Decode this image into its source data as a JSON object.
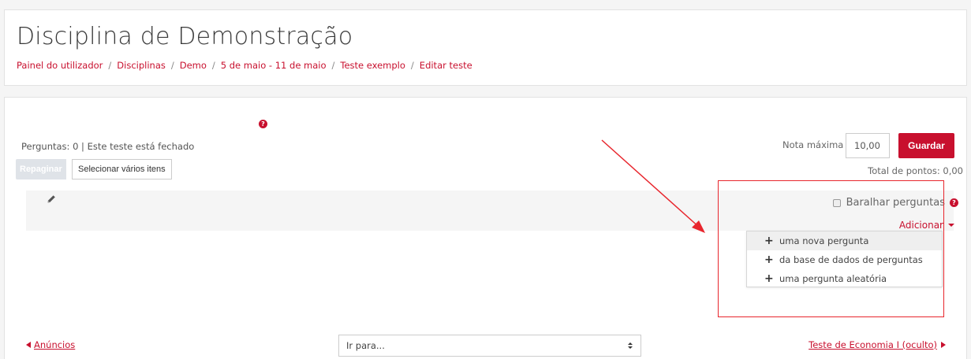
{
  "header": {
    "title": "Disciplina de Demonstração",
    "breadcrumb": [
      "Painel do utilizador",
      "Disciplinas",
      "Demo",
      "5 de maio - 11 de maio",
      "Teste exemplo",
      "Editar teste"
    ],
    "separator": "/"
  },
  "quiz": {
    "status": "Perguntas: 0 | Este teste está fechado",
    "repaginate_label": "Repaginar",
    "select_multiple_label": "Selecionar vários itens",
    "max_grade_label": "Nota máxima",
    "max_grade_value": "10,00",
    "save_label": "Guardar",
    "total_points": "Total de pontos: 0,00",
    "help_glyph": "?"
  },
  "section": {
    "shuffle_label": "Baralhar perguntas",
    "shuffle_checked": false,
    "add_label": "Adicionar",
    "add_menu": [
      "uma nova pergunta",
      "da base de dados de perguntas",
      "uma pergunta aleatória"
    ]
  },
  "footer": {
    "prev_link": "Anúncios",
    "jump_placeholder": "Ir para...",
    "next_link": "Teste de Economia I (oculto)"
  },
  "colors": {
    "accent": "#c8102e",
    "annotation": "#e8262d"
  }
}
